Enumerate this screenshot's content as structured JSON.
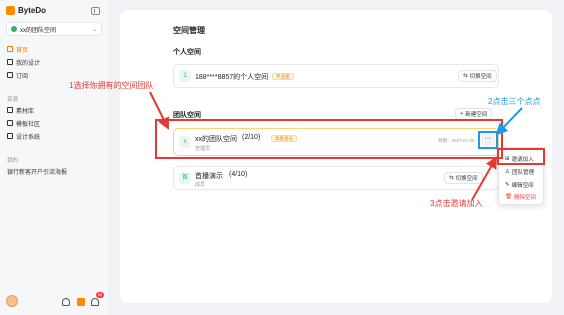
{
  "brand": {
    "name": "ByteDo",
    "color": "#ff8a00"
  },
  "sidebar": {
    "team_selector": "xx的团队空间",
    "items": [
      {
        "label": "首页",
        "icon": "home-icon",
        "active": true
      },
      {
        "label": "我的设计",
        "icon": "grid-icon"
      },
      {
        "label": "订阅",
        "icon": "subscription-icon"
      }
    ],
    "section_resources": "资源",
    "resource_items": [
      {
        "label": "素材库",
        "icon": "assets-icon"
      },
      {
        "label": "模板社区",
        "icon": "template-icon"
      },
      {
        "label": "设计系统",
        "icon": "design-system-icon"
      }
    ],
    "section_mine": "我的",
    "mine_items": [
      {
        "label": "银行新客开户引流海报"
      }
    ],
    "notification_count": "99"
  },
  "main": {
    "title": "空间管理",
    "personal_section": "个人空间",
    "personal_space": {
      "icon_letter": "1",
      "name": "188****8857的个人空间",
      "tag": "专业版",
      "action": "切换空间"
    },
    "team_section": "团队空间",
    "new_space": "新建空间",
    "team_spaces": [
      {
        "icon_letter": "x",
        "name": "xx的团队空间",
        "count": "(2/10)",
        "tag": "高级会员",
        "sub": "管理员",
        "expire": "到期：2027-07-05"
      },
      {
        "icon_letter": "首",
        "name": "首播演示",
        "count": "(4/10)",
        "sub": "成员",
        "action": "切换空间"
      }
    ],
    "more_label": "···"
  },
  "menu": {
    "items": [
      {
        "label": "邀请加入",
        "icon": "invite-icon"
      },
      {
        "label": "团队管理",
        "icon": "team-icon"
      },
      {
        "label": "编辑空间",
        "icon": "edit-icon"
      },
      {
        "label": "删除空间",
        "icon": "delete-icon",
        "danger": true
      }
    ]
  },
  "annotations": {
    "step1": "1选择你拥有的空间团队",
    "step2": "2点击三个点点",
    "step3": "3点击邀请加入",
    "red": "#e53935",
    "blue": "#1a9be8"
  }
}
